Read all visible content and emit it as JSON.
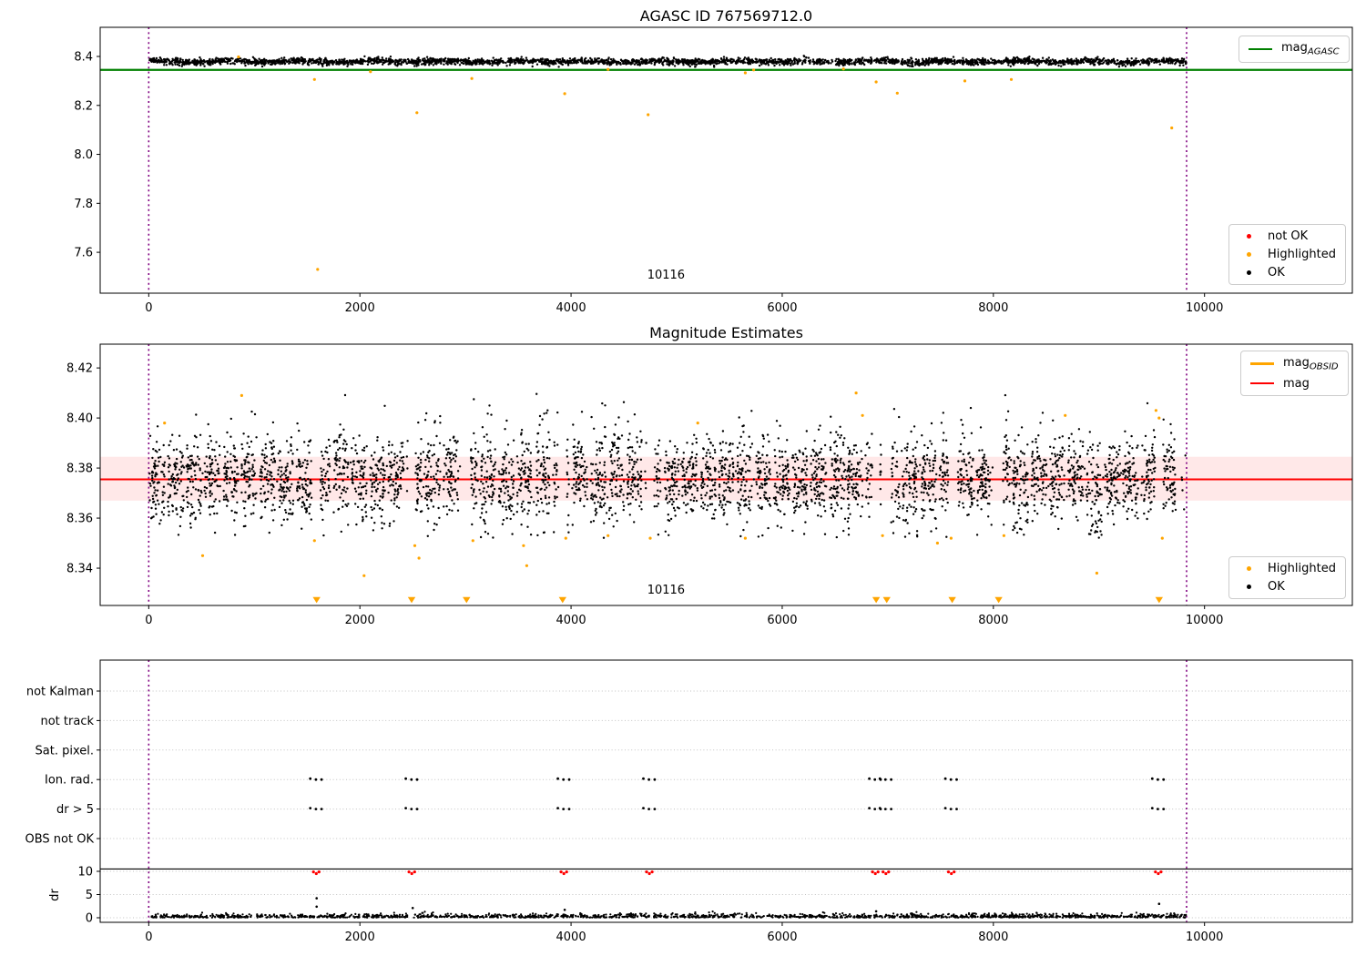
{
  "colors": {
    "ok": "#000000",
    "highlighted": "#ffa500",
    "not_ok": "#ff0000",
    "agasc_line": "#008000",
    "mag_line": "#ff0000",
    "mag_band": "rgba(255,0,0,0.09)",
    "vline": "#800080",
    "grid": "#c2c2c2",
    "spine": "#000000"
  },
  "chart_data": [
    {
      "type": "scatter",
      "title": "AGASC ID 767569712.0",
      "xlim": [
        -460,
        11400
      ],
      "ylim": [
        7.433,
        8.519
      ],
      "xticks": [
        {
          "v": 0,
          "label": "0"
        },
        {
          "v": 2000,
          "label": "2000"
        },
        {
          "v": 4000,
          "label": "4000"
        },
        {
          "v": 6000,
          "label": "6000"
        },
        {
          "v": 8000,
          "label": "8000"
        },
        {
          "v": 10000,
          "label": "10000"
        }
      ],
      "yticks": [
        {
          "v": 7.6,
          "label": "7.6"
        },
        {
          "v": 7.8,
          "label": "7.8"
        },
        {
          "v": 8.0,
          "label": "8.0"
        },
        {
          "v": 8.2,
          "label": "8.2"
        },
        {
          "v": 8.4,
          "label": "8.4"
        }
      ],
      "agasc_mag_line": 8.345,
      "vlines": [
        0,
        9830
      ],
      "annotation": "10116",
      "annotation_x": 4900,
      "band": {
        "n": 3200,
        "xmin": 0,
        "xmax": 9830,
        "mean": 8.379,
        "sigma": 0.0065,
        "clip_lo": 8.357,
        "clip_hi": 8.414,
        "wave_amp": 0.003,
        "wave_period": 680
      },
      "highlighted": [
        [
          850,
          8.398
        ],
        [
          2100,
          8.338
        ],
        [
          4350,
          8.347
        ],
        [
          5650,
          8.333
        ],
        [
          5730,
          8.345
        ],
        [
          6580,
          8.349
        ],
        [
          1570,
          8.306
        ],
        [
          3060,
          8.31
        ],
        [
          6890,
          8.296
        ],
        [
          7730,
          8.3
        ],
        [
          8170,
          8.306
        ],
        [
          2540,
          8.17
        ],
        [
          3940,
          8.248
        ],
        [
          4730,
          8.162
        ],
        [
          7090,
          8.25
        ],
        [
          9690,
          8.108
        ],
        [
          1600,
          7.53
        ]
      ],
      "legend_line": {
        "items": [
          {
            "main": "mag",
            "sub": "AGASC",
            "color": "#008000",
            "lw": 2.2
          }
        ]
      },
      "legend_markers": {
        "items": [
          {
            "label": "not OK",
            "color": "#ff0000"
          },
          {
            "label": "Highlighted",
            "color": "#ffa500"
          },
          {
            "label": "OK",
            "color": "#000000"
          }
        ]
      }
    },
    {
      "type": "scatter",
      "title": "Magnitude Estimates",
      "xlim": [
        -460,
        11400
      ],
      "ylim": [
        8.3251,
        8.4295
      ],
      "xticks": [
        {
          "v": 0,
          "label": "0"
        },
        {
          "v": 2000,
          "label": "2000"
        },
        {
          "v": 4000,
          "label": "4000"
        },
        {
          "v": 6000,
          "label": "6000"
        },
        {
          "v": 8000,
          "label": "8000"
        },
        {
          "v": 10000,
          "label": "10000"
        }
      ],
      "yticks": [
        {
          "v": 8.34,
          "label": "8.34"
        },
        {
          "v": 8.36,
          "label": "8.36"
        },
        {
          "v": 8.38,
          "label": "8.38"
        },
        {
          "v": 8.4,
          "label": "8.40"
        },
        {
          "v": 8.42,
          "label": "8.42"
        }
      ],
      "mag_line": 8.3755,
      "mag_band": [
        8.367,
        8.3845
      ],
      "vlines": [
        0,
        9830
      ],
      "annotation": "10116",
      "annotation_x": 4900,
      "clusters": {
        "count": 56,
        "start": 80,
        "step": 174,
        "half_width": 72,
        "pts": 70,
        "mean": 8.376,
        "sigma": 0.0085,
        "clip_lo": 8.352,
        "clip_hi": 8.411,
        "sparse_n": 450
      },
      "gaps_x": [
        1590,
        2490,
        3010,
        3920,
        4750,
        6890,
        6990,
        7610,
        8050,
        9570
      ],
      "triangles_x": [
        1590,
        2490,
        3010,
        3920,
        6890,
        6990,
        7610,
        8050,
        9570
      ],
      "highlighted": [
        [
          150,
          8.398
        ],
        [
          880,
          8.409
        ],
        [
          510,
          8.345
        ],
        [
          1570,
          8.351
        ],
        [
          2040,
          8.337
        ],
        [
          2520,
          8.349
        ],
        [
          2560,
          8.344
        ],
        [
          3070,
          8.351
        ],
        [
          3550,
          8.349
        ],
        [
          3580,
          8.341
        ],
        [
          3950,
          8.352
        ],
        [
          4350,
          8.353
        ],
        [
          4750,
          8.352
        ],
        [
          5200,
          8.398
        ],
        [
          5650,
          8.352
        ],
        [
          6700,
          8.41
        ],
        [
          6760,
          8.401
        ],
        [
          6950,
          8.353
        ],
        [
          7470,
          8.35
        ],
        [
          7600,
          8.352
        ],
        [
          8100,
          8.353
        ],
        [
          8680,
          8.401
        ],
        [
          8980,
          8.338
        ],
        [
          9540,
          8.403
        ],
        [
          9570,
          8.4
        ],
        [
          9600,
          8.352
        ]
      ],
      "legend_lines": {
        "items": [
          {
            "main": "mag",
            "sub": "OBSID",
            "color": "#ffa500",
            "lw": 3.5
          },
          {
            "main": "mag",
            "sub": "",
            "color": "#ff0000",
            "lw": 2
          }
        ]
      },
      "legend_markers": {
        "items": [
          {
            "label": "Highlighted",
            "color": "#ffa500"
          },
          {
            "label": "OK",
            "color": "#000000"
          }
        ]
      }
    },
    {
      "type": "flags",
      "categories": [
        "not Kalman",
        "not track",
        "Sat. pixel.",
        "Ion. rad.",
        "dr > 5",
        "OBS not OK"
      ],
      "dr_ticks": [
        {
          "v": 10,
          "label": "10"
        },
        {
          "v": 5,
          "label": "5"
        },
        {
          "v": 0,
          "label": "0"
        }
      ],
      "ylabel": "dr",
      "xticks": [
        {
          "v": 0,
          "label": "0"
        },
        {
          "v": 2000,
          "label": "2000"
        },
        {
          "v": 4000,
          "label": "4000"
        },
        {
          "v": 6000,
          "label": "6000"
        },
        {
          "v": 8000,
          "label": "8000"
        },
        {
          "v": 10000,
          "label": "10000"
        }
      ],
      "vlines": [
        0,
        9830
      ],
      "flag_rows_with_dots": [
        "Ion. rad.",
        "dr > 5"
      ],
      "flag_dot_x": [
        1595,
        2500,
        3940,
        4750,
        6890,
        6990,
        7610,
        9570
      ],
      "red_dr_x": [
        1595,
        2500,
        3940,
        4750,
        6890,
        6990,
        7610,
        9570
      ],
      "mid_dr_points": [
        [
          1590,
          4.2
        ],
        [
          1590,
          2.4
        ],
        [
          2500,
          2.1
        ],
        [
          3940,
          1.7
        ],
        [
          6890,
          1.4
        ],
        [
          9570,
          3.0
        ]
      ],
      "dr_band": {
        "n": 1750,
        "xmin": 0,
        "xmax": 9830,
        "sigma": 0.38
      },
      "separator_dr": 10.5
    }
  ]
}
